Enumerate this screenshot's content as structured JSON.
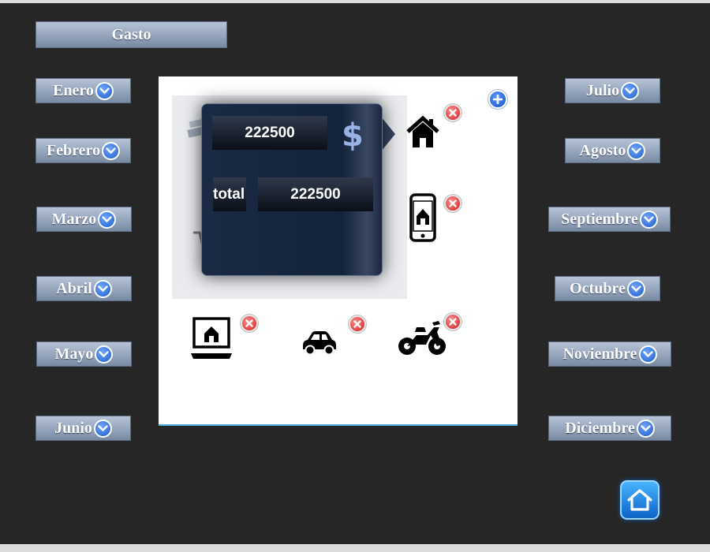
{
  "header": {
    "gasto_label": "Gasto"
  },
  "months_left": [
    {
      "label": "Enero"
    },
    {
      "label": "Febrero"
    },
    {
      "label": "Marzo"
    },
    {
      "label": "Abril"
    },
    {
      "label": "Mayo"
    },
    {
      "label": "Junio"
    }
  ],
  "months_right": [
    {
      "label": "Julio"
    },
    {
      "label": "Agosto"
    },
    {
      "label": "Septiembre"
    },
    {
      "label": "Octubre"
    },
    {
      "label": "Noviembre"
    },
    {
      "label": "Diciembre"
    }
  ],
  "popup": {
    "amount_value": "222500",
    "currency_symbol": "$",
    "total_label": "total",
    "total_value": "222500"
  },
  "expense_items": [
    {
      "icon": "house-icon"
    },
    {
      "icon": "smartphone-icon"
    },
    {
      "icon": "laptop-icon"
    },
    {
      "icon": "car-icon"
    },
    {
      "icon": "motorcycle-icon"
    }
  ],
  "colors": {
    "background": "#262626",
    "button_gradient_top": "#b7c4d7",
    "button_gradient_bottom": "#7889a3",
    "accent_blue": "#1e5ec8",
    "delete_red": "#d11f1f"
  }
}
